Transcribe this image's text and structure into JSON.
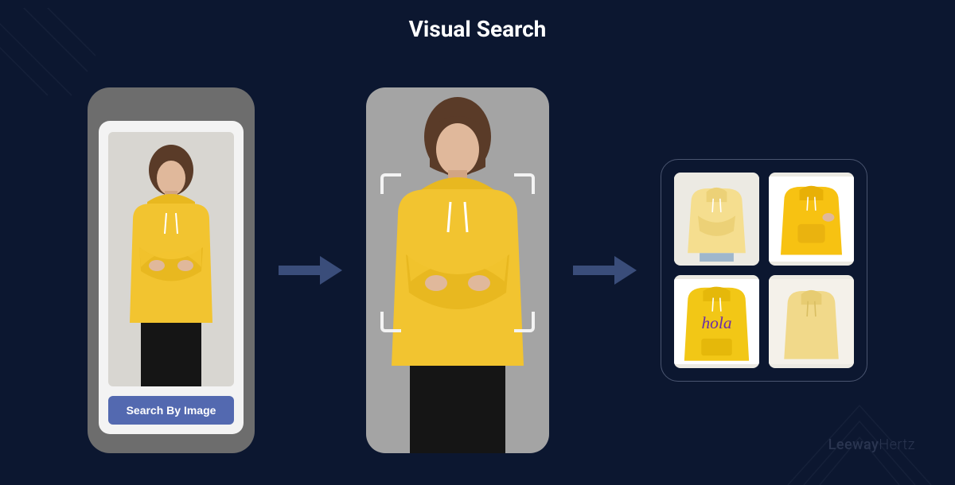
{
  "title": "Visual Search",
  "phone": {
    "search_button_label": "Search By Image",
    "query_subject": "person-yellow-hoodie"
  },
  "detection": {
    "subject": "person-yellow-hoodie",
    "focus_region": "torso-hoodie"
  },
  "results": {
    "items": [
      {
        "name": "yellow-hoodie-light",
        "text": ""
      },
      {
        "name": "yellow-hoodie-bright",
        "text": ""
      },
      {
        "name": "yellow-hoodie-hola",
        "text": "hola"
      },
      {
        "name": "yellow-hoodie-pale",
        "text": ""
      }
    ]
  },
  "watermark": {
    "brand_a": "Leeway",
    "brand_b": "Hertz"
  },
  "colors": {
    "bg": "#0c1730",
    "arrow": "#3a4d7a",
    "button": "#5369b0",
    "hoodie": "#f2c430",
    "hoodie_light": "#f5de8f",
    "hoodie_bright": "#f7c212",
    "hoodie_pale": "#f1d98a",
    "skin": "#e0b89b",
    "hair": "#5a3b28",
    "pants": "#151515"
  }
}
